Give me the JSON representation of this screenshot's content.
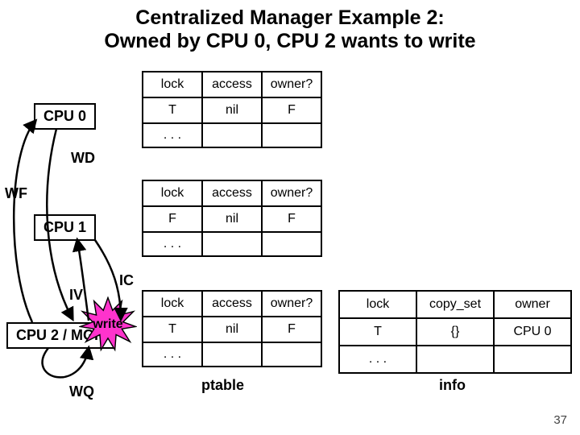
{
  "title_line1": "Centralized Manager Example 2:",
  "title_line2": "Owned by CPU 0, CPU 2 wants to write",
  "cpu0": "CPU 0",
  "cpu1": "CPU 1",
  "cpu2": "CPU 2 / MGR",
  "annot": {
    "wd": "WD",
    "wf": "WF",
    "ic": "IC",
    "iv": "IV",
    "wq": "WQ"
  },
  "write_label": "write",
  "ptable_hdr": {
    "lock": "lock",
    "access": "access",
    "owner": "owner?"
  },
  "ptable_rows": {
    "cpu0": {
      "lock": "T",
      "access": "nil",
      "owner": "F",
      "cont": ". . ."
    },
    "cpu1": {
      "lock": "F",
      "access": "nil",
      "owner": "F",
      "cont": ". . ."
    },
    "cpu2": {
      "lock": "T",
      "access": "nil",
      "owner": "F",
      "cont": ". . ."
    }
  },
  "info_hdr": {
    "lock": "lock",
    "copy": "copy_set",
    "owner": "owner"
  },
  "info_row": {
    "lock": "T",
    "copy": "{}",
    "owner": "CPU 0",
    "cont": ". . ."
  },
  "caption_ptable": "ptable",
  "caption_info": "info",
  "pagenum": "37",
  "chart_data": {
    "type": "table",
    "title": "Centralized Manager Example 2: Owned by CPU 0, CPU 2 wants to write",
    "ptable": [
      {
        "cpu": "CPU 0",
        "lock": "T",
        "access": "nil",
        "owner?": "F"
      },
      {
        "cpu": "CPU 1",
        "lock": "F",
        "access": "nil",
        "owner?": "F"
      },
      {
        "cpu": "CPU 2 / MGR",
        "lock": "T",
        "access": "nil",
        "owner?": "F"
      }
    ],
    "info": [
      {
        "lock": "T",
        "copy_set": "{}",
        "owner": "CPU 0"
      }
    ],
    "arrows": [
      "WD",
      "WF",
      "IC",
      "IV",
      "WQ"
    ],
    "action": "write"
  }
}
